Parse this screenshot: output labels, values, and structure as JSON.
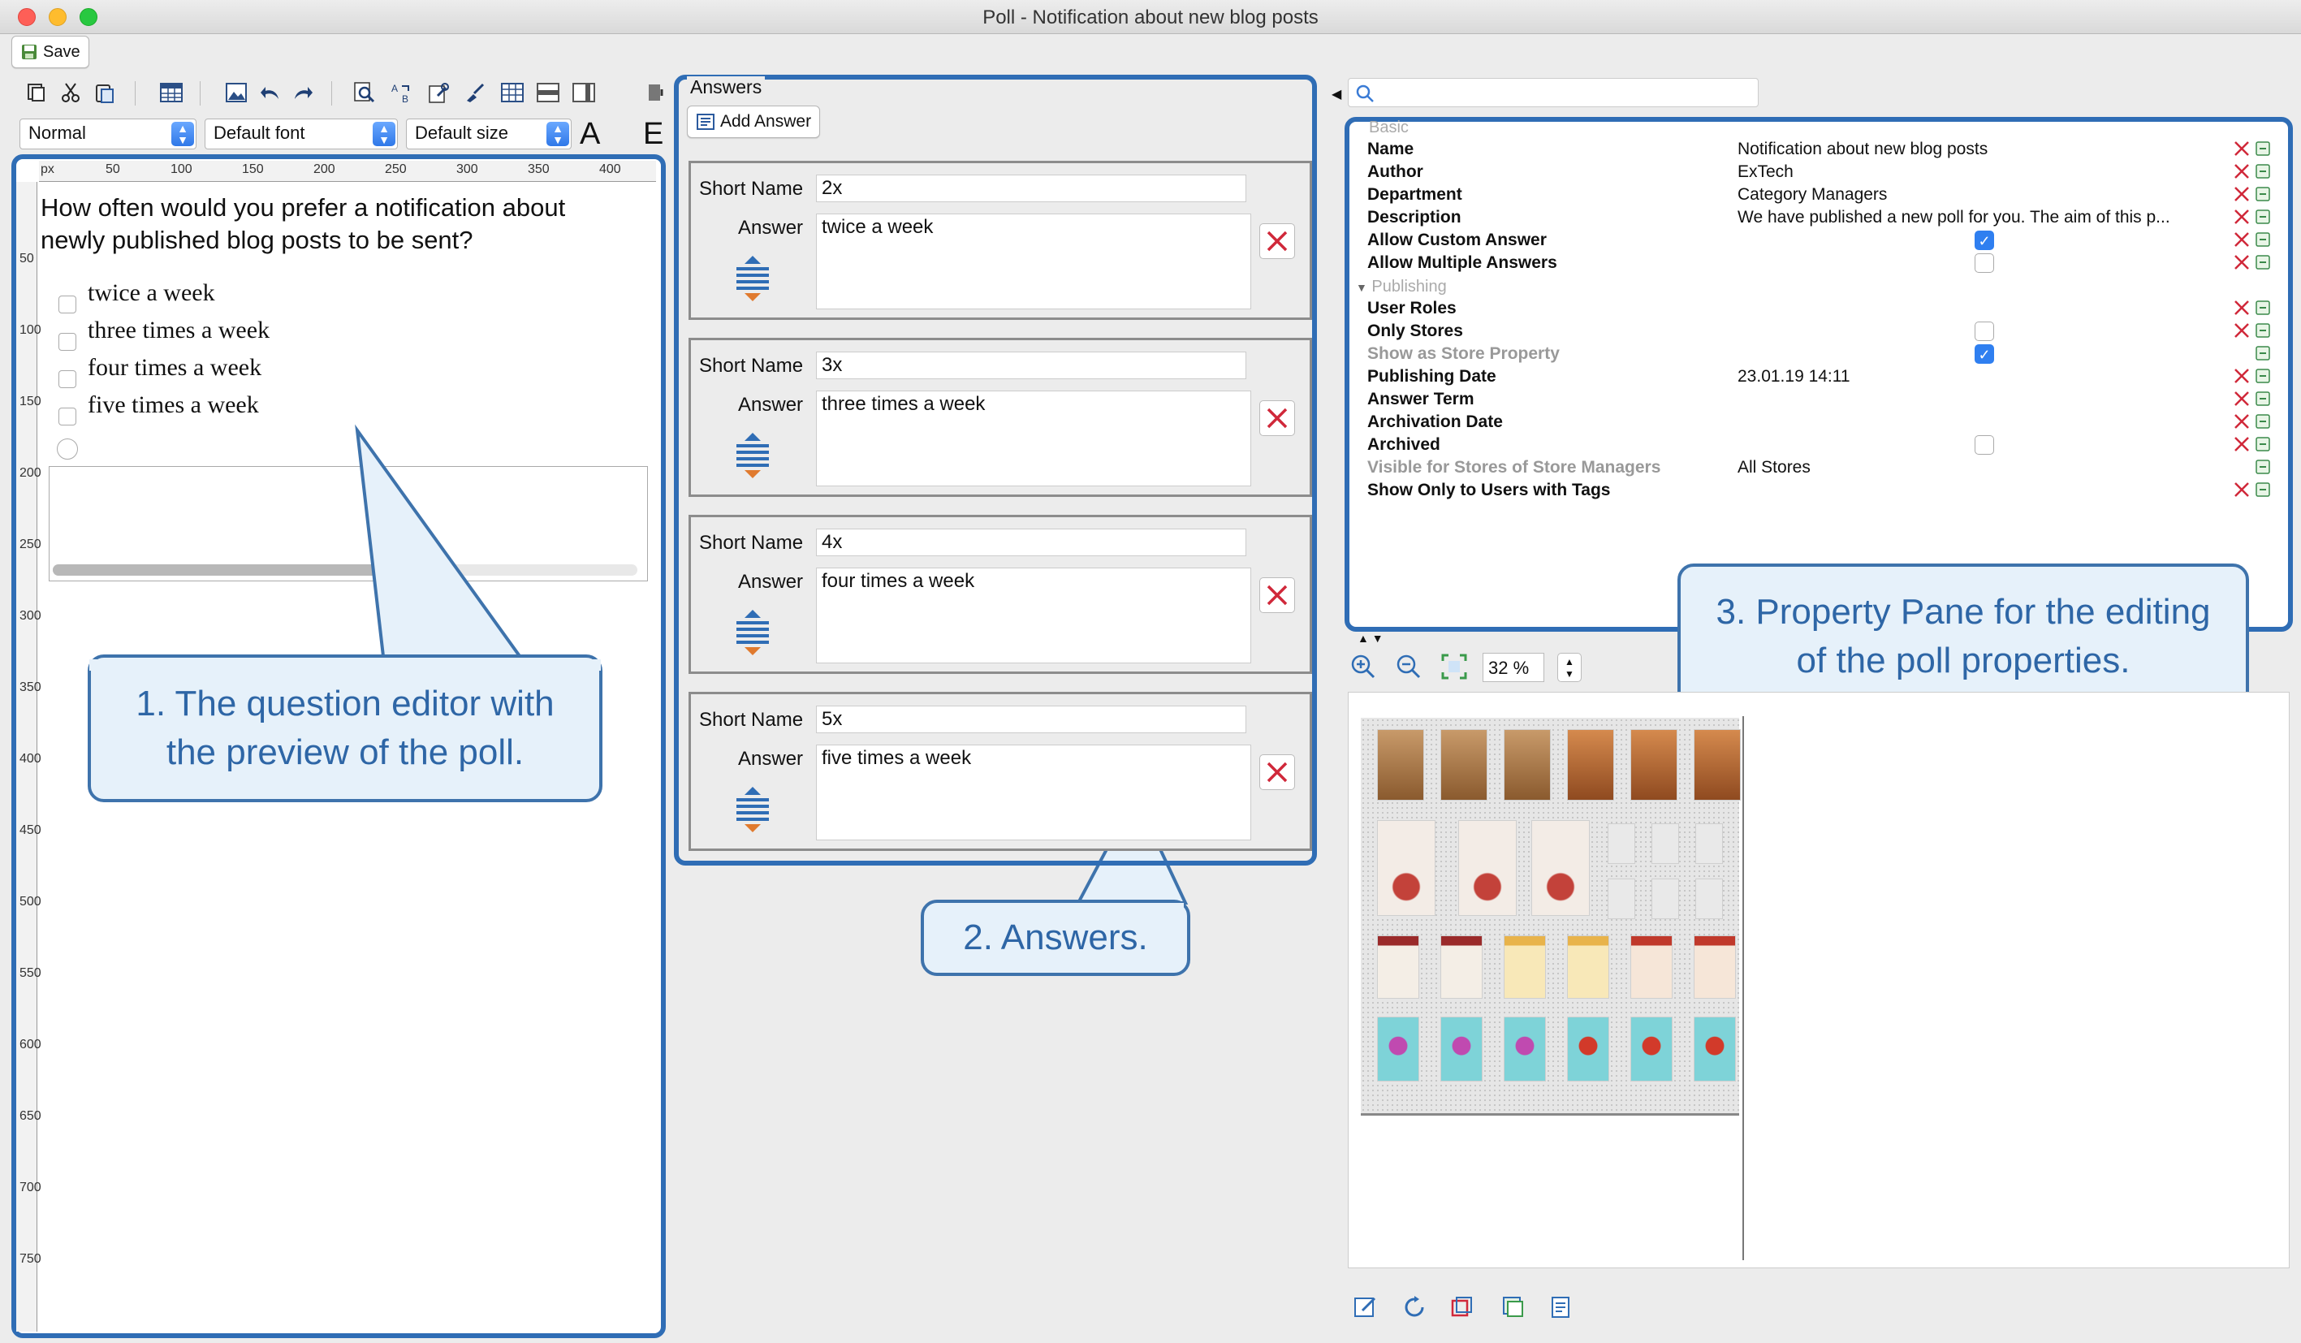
{
  "window": {
    "title": "Poll - Notification about new blog posts"
  },
  "toolbar": {
    "save_label": "Save",
    "style_value": "Normal",
    "font_value": "Default font",
    "size_value": "Default size"
  },
  "editor": {
    "ruler_unit": "px",
    "h_ticks": [
      "50",
      "100",
      "150",
      "200",
      "250",
      "300",
      "350",
      "400"
    ],
    "v_ticks": [
      "50",
      "100",
      "150",
      "200",
      "250",
      "300",
      "350",
      "400",
      "450",
      "500",
      "550",
      "600",
      "650",
      "700",
      "750"
    ],
    "question_line1": "How often would you prefer a notification about",
    "question_line2": "newly published blog posts to be sent?",
    "options": [
      "twice a week",
      "three times a week",
      "four times a week",
      "five times a week"
    ]
  },
  "answers": {
    "section_title": "Answers",
    "add_label": "Add Answer",
    "short_name_label": "Short Name",
    "answer_label": "Answer",
    "items": [
      {
        "short": "2x",
        "text": "twice a week"
      },
      {
        "short": "3x",
        "text": "three times a week"
      },
      {
        "short": "4x",
        "text": "four times a week"
      },
      {
        "short": "5x",
        "text": "five times a week"
      }
    ]
  },
  "properties": {
    "group_basic": "Basic",
    "group_publishing": "Publishing",
    "rows": [
      {
        "key": "Name",
        "value": "Notification about new blog posts",
        "type": "text"
      },
      {
        "key": "Author",
        "value": "ExTech",
        "type": "text"
      },
      {
        "key": "Department",
        "value": "Category Managers",
        "type": "text"
      },
      {
        "key": "Description",
        "value": "We have published a new poll for you. The aim of this p...",
        "type": "text"
      },
      {
        "key": "Allow Custom Answer",
        "value": "true",
        "type": "checkbox"
      },
      {
        "key": "Allow Multiple Answers",
        "value": "false",
        "type": "checkbox"
      },
      {
        "key": "User Roles",
        "value": "",
        "type": "text"
      },
      {
        "key": "Only Stores",
        "value": "false",
        "type": "checkbox"
      },
      {
        "key": "Show as Store Property",
        "value": "true",
        "type": "checkbox"
      },
      {
        "key": "Publishing Date",
        "value": "23.01.19 14:11",
        "type": "text"
      },
      {
        "key": "Answer Term",
        "value": "",
        "type": "text"
      },
      {
        "key": "Archivation Date",
        "value": "",
        "type": "text"
      },
      {
        "key": "Archived",
        "value": "false",
        "type": "checkbox"
      },
      {
        "key": "Visible for Stores of Store Managers",
        "value": "All Stores",
        "type": "text"
      },
      {
        "key": "Show Only to Users with Tags",
        "value": "",
        "type": "text"
      }
    ]
  },
  "preview": {
    "zoom": "32 %"
  },
  "callouts": {
    "one_l1": "1. The question editor with",
    "one_l2": "the preview of the poll.",
    "two": "2. Answers.",
    "three_l1": "3. Property Pane for the editing",
    "three_l2": "of the poll properties."
  },
  "colors": {
    "accent": "#2f6db5",
    "callout_bg": "#e6f1fa",
    "delete_red": "#d0283a"
  }
}
